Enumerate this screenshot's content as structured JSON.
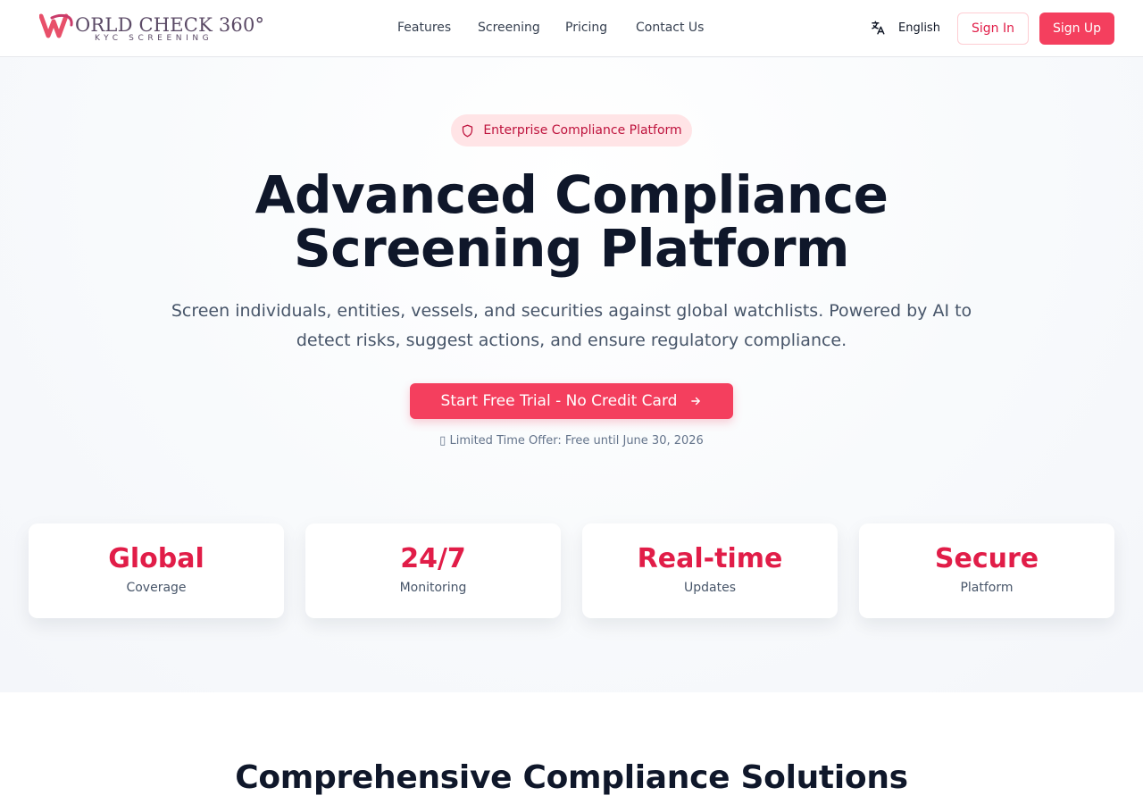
{
  "brand": {
    "name": "ORLD CHECK 360°",
    "tagline": "KYC SCREENING",
    "accent": "#f43f5e"
  },
  "nav": {
    "items": [
      {
        "label": "Features"
      },
      {
        "label": "Screening"
      },
      {
        "label": "Pricing"
      },
      {
        "label": "Contact Us"
      }
    ]
  },
  "header": {
    "language": "English",
    "language_icon": "translate-icon",
    "sign_in": "Sign In",
    "sign_up": "Sign Up"
  },
  "hero": {
    "badge": "Enterprise Compliance Platform",
    "badge_icon": "shield-icon",
    "title_line1": "Advanced Compliance",
    "title_line2": "Screening Platform",
    "subtitle_line1": "Screen individuals, entities, vessels, and securities against global watchlists. Powered by AI to",
    "subtitle_line2": "detect risks, suggest actions, and ensure regulatory compliance.",
    "cta": "Start Free Trial - No Credit Card",
    "cta_icon": "arrow-right-icon",
    "offer": "▯ Limited Time Offer: Free until June 30, 2026"
  },
  "stats": [
    {
      "value": "Global",
      "label": "Coverage"
    },
    {
      "value": "24/7",
      "label": "Monitoring"
    },
    {
      "value": "Real-time",
      "label": "Updates"
    },
    {
      "value": "Secure",
      "label": "Platform"
    }
  ],
  "solutions": {
    "title": "Comprehensive Compliance Solutions"
  }
}
